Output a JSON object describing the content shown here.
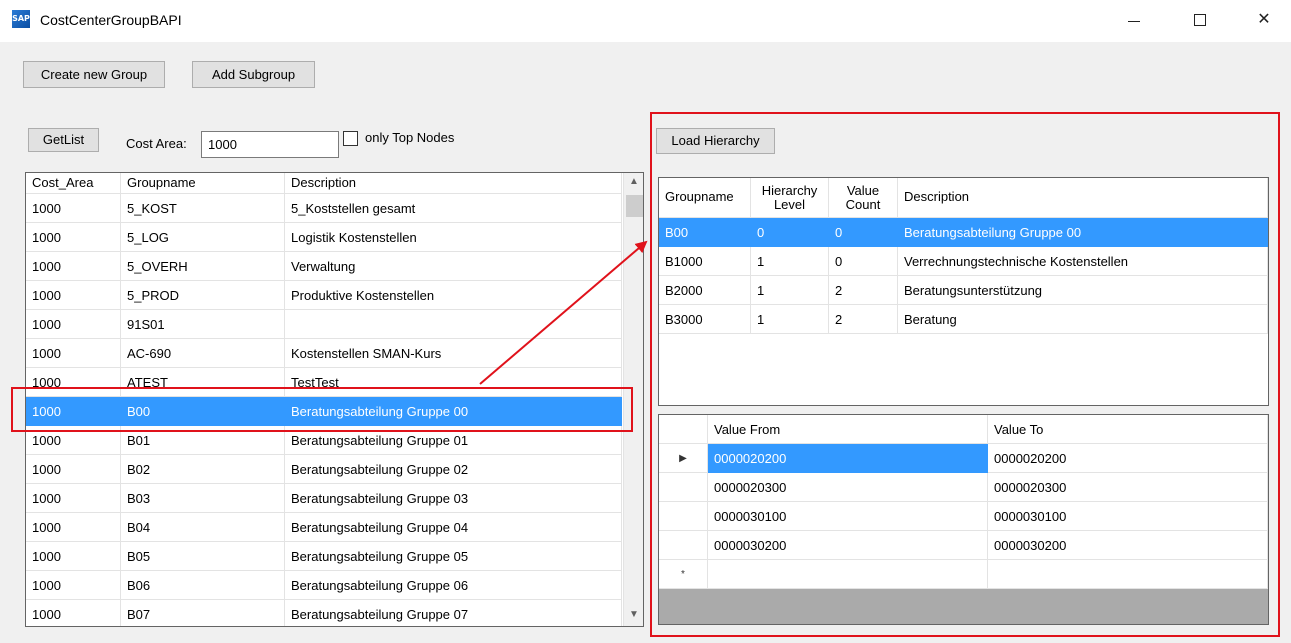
{
  "window": {
    "title": "CostCenterGroupBAPI",
    "logo_text": "SAP"
  },
  "toolbar": {
    "create_group_label": "Create new Group",
    "add_subgroup_label": "Add Subgroup",
    "getlist_label": "GetList",
    "cost_area_label": "Cost Area:",
    "cost_area_value": "1000",
    "only_top_nodes_label": "only Top Nodes",
    "only_top_nodes_checked": false,
    "load_hierarchy_label": "Load Hierarchy"
  },
  "group_grid": {
    "columns": [
      "Cost_Area",
      "Groupname",
      "Description"
    ],
    "selected_index": 7,
    "rows": [
      [
        "1000",
        "5_KOST",
        "5_Koststellen gesamt"
      ],
      [
        "1000",
        "5_LOG",
        "Logistik Kostenstellen"
      ],
      [
        "1000",
        "5_OVERH",
        "Verwaltung"
      ],
      [
        "1000",
        "5_PROD",
        "Produktive Kostenstellen"
      ],
      [
        "1000",
        "91S01",
        ""
      ],
      [
        "1000",
        "AC-690",
        "Kostenstellen SMAN-Kurs"
      ],
      [
        "1000",
        "ATEST",
        "TestTest"
      ],
      [
        "1000",
        "B00",
        "Beratungsabteilung Gruppe 00"
      ],
      [
        "1000",
        "B01",
        "Beratungsabteilung Gruppe 01"
      ],
      [
        "1000",
        "B02",
        "Beratungsabteilung Gruppe 02"
      ],
      [
        "1000",
        "B03",
        "Beratungsabteilung Gruppe 03"
      ],
      [
        "1000",
        "B04",
        "Beratungsabteilung Gruppe 04"
      ],
      [
        "1000",
        "B05",
        "Beratungsabteilung Gruppe 05"
      ],
      [
        "1000",
        "B06",
        "Beratungsabteilung Gruppe 06"
      ],
      [
        "1000",
        "B07",
        "Beratungsabteilung Gruppe 07"
      ]
    ]
  },
  "hierarchy_grid": {
    "columns": [
      {
        "line1": "Groupname",
        "line2": ""
      },
      {
        "line1": "Hierarchy",
        "line2": "Level"
      },
      {
        "line1": "Value",
        "line2": "Count"
      },
      {
        "line1": "Description",
        "line2": ""
      }
    ],
    "selected_index": 0,
    "rows": [
      [
        "B00",
        "0",
        "0",
        "Beratungsabteilung Gruppe 00"
      ],
      [
        "B1000",
        "1",
        "0",
        "Verrechnungstechnische Kostenstellen"
      ],
      [
        "B2000",
        "1",
        "2",
        "Beratungsunterstützung"
      ],
      [
        "B3000",
        "1",
        "2",
        "Beratung"
      ]
    ]
  },
  "values_grid": {
    "columns": [
      "Value From",
      "Value To"
    ],
    "selected_index": 0,
    "current_row_marker": "▶",
    "new_row_marker": "*",
    "rows": [
      [
        "0000020200",
        "0000020200"
      ],
      [
        "0000020300",
        "0000020300"
      ],
      [
        "0000030100",
        "0000030100"
      ],
      [
        "0000030200",
        "0000030200"
      ]
    ]
  },
  "colors": {
    "selection": "#3399ff",
    "annotation": "#e0121b"
  }
}
